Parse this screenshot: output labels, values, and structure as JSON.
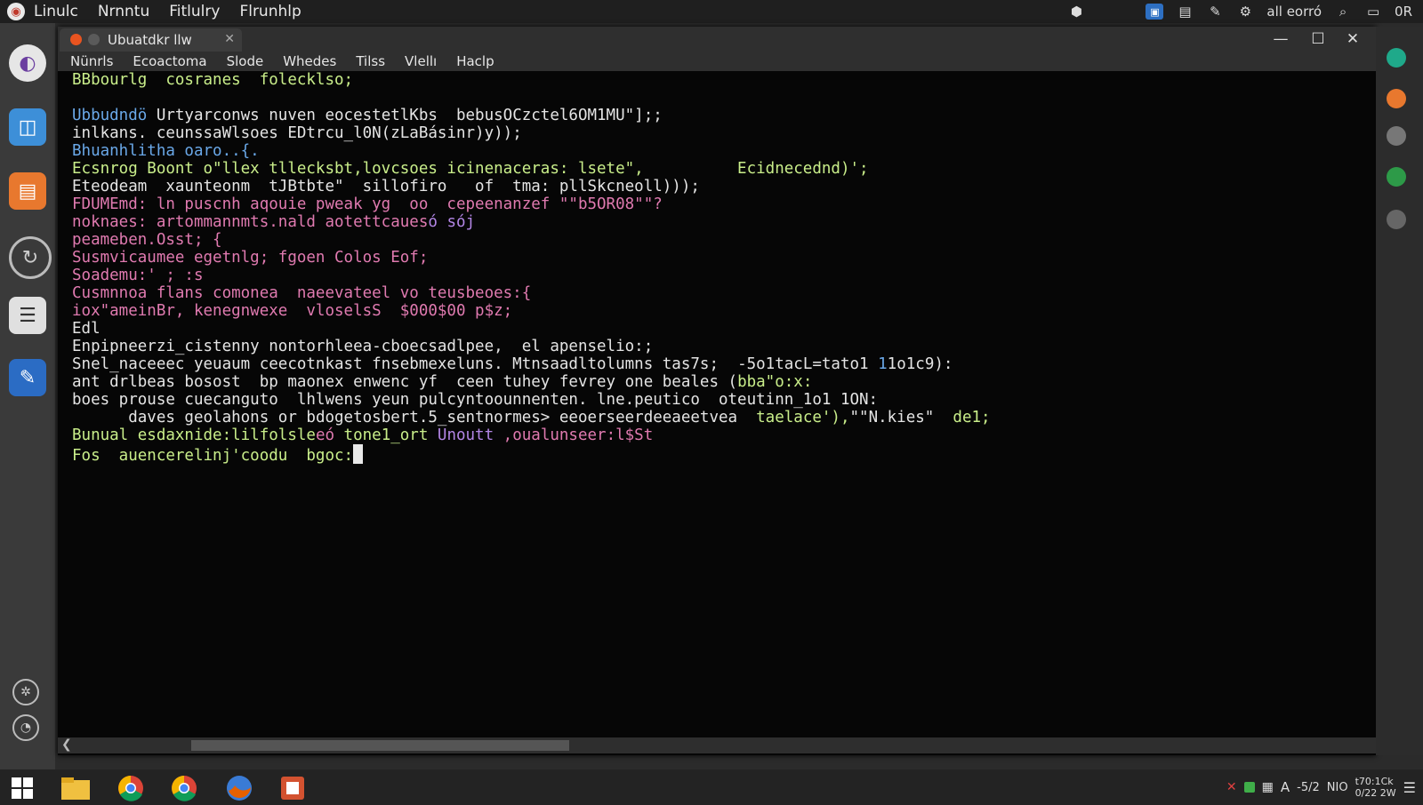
{
  "top_panel": {
    "menus": [
      "Linulc",
      "Nrnntu",
      "Fitlulry",
      "Flrunhlp"
    ],
    "tray_text": "all eorró",
    "tray_text2": "0R"
  },
  "window": {
    "tab_title": "Ubuatdkr llw",
    "menus": [
      "Nünrls",
      "Ecoactoma",
      "Slode",
      "Whedes",
      "Tilss",
      "Vlellı",
      "Haclp"
    ]
  },
  "terminal": {
    "lines": [
      [
        {
          "t": "BBbourlg  cosranes  folecklso;",
          "c": "g"
        }
      ],
      [],
      [
        {
          "t": "Ubbudndö ",
          "c": "b"
        },
        {
          "t": "Urtyarconws nuven eocestetlKbs  bebusOCzctel6OM1MU\"];;",
          "c": "w"
        }
      ],
      [
        {
          "t": "inlkans. ceunssaWlsoes ",
          "c": "w"
        },
        {
          "t": "EDtrcu_l0N(zLaBásinr)y));",
          "c": "w"
        }
      ],
      [
        {
          "t": "Bhuanhlitha oaro..{.",
          "c": "b"
        }
      ],
      [
        {
          "t": "Ecsnrog Boont o\"llex tllecksbt,lovcsoes icinenaceras: lsete\",          Ecidnecednd)';",
          "c": "g"
        }
      ],
      [
        {
          "t": "Eteodeam  xaunteonm  tJBtbte\"  sillofiro   of  tma: pllSkcneoll)));",
          "c": "w"
        }
      ],
      [
        {
          "t": "FDUMEmd: ln puscnh aqouie pweak yg  oo  cepeenanzef \"\"b5OR08\"\"?",
          "c": "p"
        }
      ],
      [
        {
          "t": "noknaes: artommannmts.nald aotettcaues",
          "c": "p"
        },
        {
          "t": "ó sój",
          "c": "v"
        }
      ],
      [
        {
          "t": "peameben.Osst; {",
          "c": "p"
        }
      ],
      [
        {
          "t": "Susmvicaumee egetnlg; fgoen Colos Eof;",
          "c": "p"
        }
      ],
      [
        {
          "t": "Soademu:' ; :s",
          "c": "p"
        }
      ],
      [
        {
          "t": "Cusmnnoa flans comonea  naeevateel vo teusbeoes:{",
          "c": "p"
        }
      ],
      [
        {
          "t": "iox\"ameinBr, kenegnwexe  vloselsS  $000$00 p$z;",
          "c": "p"
        }
      ],
      [
        {
          "t": "Edl",
          "c": "w"
        }
      ],
      [
        {
          "t": "Enpipneerzi_cistenny nontorhleea-cboecsadlpee,  el apenselio:;",
          "c": "w"
        }
      ],
      [
        {
          "t": "Snel_naceeec yeuaum ceecotnkast fnsebmexeluns. Mtnsaadltolumns tas7s;  ",
          "c": "w"
        },
        {
          "t": "-5o1tac",
          "c": "w"
        },
        {
          "t": "L=tato1 ",
          "c": "w"
        },
        {
          "t": "1",
          "c": "b"
        },
        {
          "t": "1o1c9):",
          "c": "w"
        }
      ],
      [
        {
          "t": "ant drlbeas bosost  bp maonex enwenc yf  ceen tuhey fevrey one beales (",
          "c": "w"
        },
        {
          "t": "bba\"o:x:",
          "c": "g"
        }
      ],
      [
        {
          "t": "boes prouse cuecanguto  lhlwens yeun pulcyntoounnenten. lne.peutico  oteutinn_1o1 1ON:",
          "c": "w"
        }
      ],
      [
        {
          "t": "      daves geolahons or ",
          "c": "w"
        },
        {
          "t": "bdogetosbert.5_sentnormes> eeoerseerdeeaeetvea  ",
          "c": "w"
        },
        {
          "t": "taelace'),",
          "c": "g"
        },
        {
          "t": "\"\"N.kies\"  ",
          "c": "w"
        },
        {
          "t": "de1;",
          "c": "g"
        }
      ],
      [
        {
          "t": "Bunual esdaxnide:lilfolsle",
          "c": "g"
        },
        {
          "t": "eó ",
          "c": "p"
        },
        {
          "t": "tone1_ort ",
          "c": "g"
        },
        {
          "t": "Unoutt ",
          "c": "v"
        },
        {
          "t": ",oualunseer:l$St",
          "c": "p"
        }
      ],
      [
        {
          "t": "Fos  auencerelinj'coodu  bgoc:",
          "c": "g"
        }
      ]
    ],
    "prompt_cursor": true
  },
  "taskbar": {
    "tray_text": "-5/2",
    "tray_text2": "NIO",
    "clock_time": "t70:1Ck",
    "clock_date": "0/22 2W"
  },
  "colors": {
    "accent": "#e95420",
    "term_green": "#c9ee8a",
    "term_blue": "#6aa8e8",
    "term_pink": "#e07ab0"
  }
}
